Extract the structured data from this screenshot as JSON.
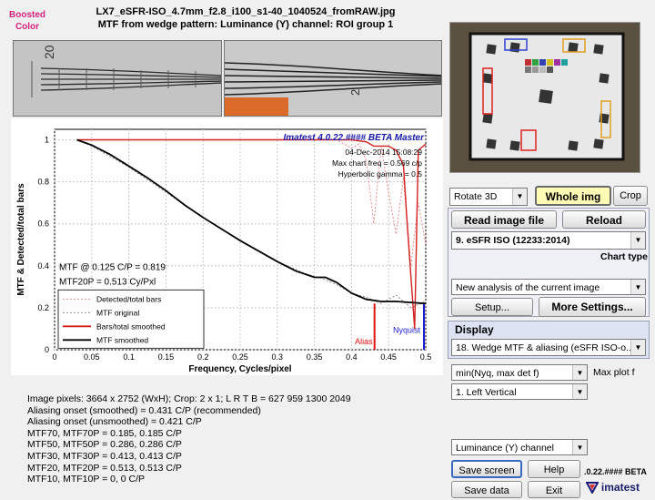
{
  "header": {
    "boosted_line1": "Boosted",
    "boosted_line2": "Color",
    "title_line1": "LX7_eSFR-ISO_4.7mm_f2.8_i100_s1-40_1040524_fromRAW.jpg",
    "title_line2": "MTF from wedge pattern:  Luminance (Y) channel:  ROI group 1"
  },
  "crop_left": {
    "tick_label": "20"
  },
  "crop_right": {
    "tick_label": "2"
  },
  "plot": {
    "version": "Imatest 4.0.22.#### BETA Master",
    "date": "04-Dec-2014 15:08:29",
    "max_freq": "Max chart freq = 0.569 c/p",
    "hyperbolic": "Hyperbolic   gamma = 0.5",
    "mtf_at": "MTF @ 0.125 C/P = 0.819",
    "mtf20p": "MTF20P = 0.513 Cy/Pxl",
    "alias_label": "Alias",
    "nyquist_label": "Nyquist"
  },
  "chart_data": {
    "type": "line",
    "title": "",
    "xlabel": "Frequency, Cycles/pixel",
    "ylabel": "MTF & Detected/total bars",
    "xlim": [
      0,
      0.5
    ],
    "ylim": [
      0,
      1.05
    ],
    "xticks": [
      "0",
      "0.05",
      "0.1",
      "0.15",
      "0.2",
      "0.25",
      "0.3",
      "0.35",
      "0.4",
      "0.45",
      "0.5"
    ],
    "yticks": [
      "0",
      "0.2",
      "0.4",
      "0.6",
      "0.8",
      "1"
    ],
    "grid": true,
    "legend_position": "lower-left",
    "alias_x": 0.431,
    "nyquist_x": 0.5,
    "series": [
      {
        "name": "Detected/total bars",
        "color": "#e88a8a",
        "style": "dotted",
        "x": [
          0.03,
          0.1,
          0.2,
          0.3,
          0.38,
          0.4,
          0.41,
          0.42,
          0.43,
          0.44,
          0.45,
          0.46,
          0.47,
          0.48,
          0.49,
          0.5
        ],
        "y": [
          1,
          1,
          1,
          1,
          1,
          0.96,
          0.98,
          0.9,
          0.6,
          0.97,
          0.75,
          0.55,
          0.82,
          0.4,
          0.7,
          0.5
        ]
      },
      {
        "name": "MTF original",
        "color": "#909090",
        "style": "dotted",
        "x": [
          0.03,
          0.05,
          0.1,
          0.15,
          0.2,
          0.25,
          0.3,
          0.34,
          0.36,
          0.38,
          0.4,
          0.42,
          0.44,
          0.46,
          0.48,
          0.5
        ],
        "y": [
          1,
          0.97,
          0.87,
          0.75,
          0.63,
          0.52,
          0.42,
          0.36,
          0.34,
          0.31,
          0.27,
          0.25,
          0.22,
          0.26,
          0.2,
          0.23
        ]
      },
      {
        "name": "Bars/total smoothed",
        "color": "#d42020",
        "style": "solid",
        "x": [
          0.03,
          0.35,
          0.4,
          0.42,
          0.43,
          0.45,
          0.46,
          0.47,
          0.475,
          0.48,
          0.485,
          0.49,
          0.5
        ],
        "y": [
          1,
          1,
          1,
          0.99,
          0.97,
          0.97,
          0.95,
          0.88,
          0.6,
          0.35,
          0.1,
          0.95,
          0.98
        ]
      },
      {
        "name": "MTF smoothed",
        "color": "#000000",
        "style": "solid",
        "x": [
          0.03,
          0.05,
          0.075,
          0.1,
          0.125,
          0.15,
          0.175,
          0.2,
          0.225,
          0.25,
          0.275,
          0.3,
          0.325,
          0.35,
          0.365,
          0.38,
          0.4,
          0.42,
          0.44,
          0.46,
          0.48,
          0.5
        ],
        "y": [
          1,
          0.975,
          0.93,
          0.875,
          0.819,
          0.758,
          0.69,
          0.63,
          0.575,
          0.52,
          0.47,
          0.42,
          0.375,
          0.345,
          0.345,
          0.32,
          0.27,
          0.24,
          0.23,
          0.23,
          0.225,
          0.22
        ]
      }
    ]
  },
  "stats": [
    "Image pixels: 3664 x 2752 (WxH);   Crop: 2 x 1;   L R T B = 627 959 1300 2049",
    "Aliasing onset (smoothed) = 0.431 C/P (recommended)",
    "Aliasing onset (unsmoothed) = 0.421 C/P",
    "MTF70, MTF70P = 0.185, 0.185 C/P",
    "MTF50, MTF50P = 0.286, 0.286 C/P",
    "MTF30, MTF30P = 0.413, 0.413 C/P",
    "MTF20, MTF20P = 0.513, 0.513 C/P",
    "MTF10, MTF10P = 0, 0 C/P"
  ],
  "controls": {
    "rotate": "Rotate 3D",
    "whole_img": "Whole img",
    "crop": "Crop",
    "read_image_file": "Read image file",
    "reload": "Reload",
    "chart_select": "9. eSFR ISO  (12233:2014)",
    "chart_type_label": "Chart type",
    "analysis_select": "New analysis of the current image",
    "setup": "Setup...",
    "more_settings": "More Settings...",
    "display_label": "Display",
    "display_select": "18. Wedge MTF & aliasing (eSFR ISO-o...",
    "maxplot_select": "min(Nyq, max det f)",
    "maxplot_label": "Max plot f",
    "roi_select": "1. Left Vertical",
    "channel_select": "Luminance (Y) channel",
    "save_screen": "Save screen",
    "help": "Help",
    "save_data": "Save data",
    "exit": "Exit",
    "version_short": ".0.22.#### BETA",
    "brand": "imatest"
  },
  "colors": {
    "accent_yellow": "#fffbb5",
    "display_panel": "#dde3f3",
    "title_blue": "#1a1aa8",
    "nyquist_blue": "#1a1ad0",
    "alias_red": "#e01010"
  }
}
